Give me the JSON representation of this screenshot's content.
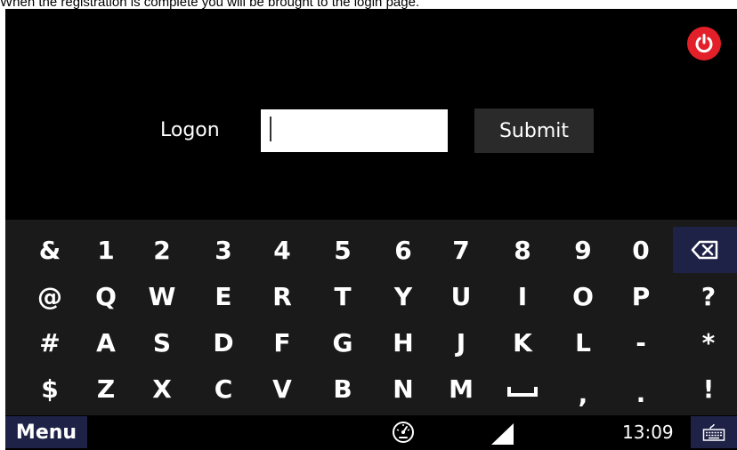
{
  "caption": "When the registration is complete you will be brought to the login page.",
  "logon": {
    "label": "Logon",
    "input_value": "",
    "submit_label": "Submit"
  },
  "keyboard": {
    "rows": [
      [
        "&",
        "1",
        "2",
        "3",
        "4",
        "5",
        "6",
        "7",
        "8",
        "9",
        "0"
      ],
      [
        "@",
        "Q",
        "W",
        "E",
        "R",
        "T",
        "Y",
        "U",
        "I",
        "O",
        "P",
        "?"
      ],
      [
        "#",
        "A",
        "S",
        "D",
        "F",
        "G",
        "H",
        "J",
        "K",
        "L",
        "-",
        "*"
      ],
      [
        "$",
        "Z",
        "X",
        "C",
        "V",
        "B",
        "N",
        "M",
        "space",
        ",",
        ".",
        "!"
      ]
    ],
    "backspace_icon": "backspace-icon"
  },
  "taskbar": {
    "menu_label": "Menu",
    "clock": "13:09",
    "icons": [
      "gauge-icon",
      "signal-icon",
      "keyboard-icon"
    ]
  },
  "colors": {
    "power": "#e3202a",
    "accent": "#1e2247",
    "keyboard_bg": "#1a1a1a",
    "screen_bg": "#000000"
  }
}
